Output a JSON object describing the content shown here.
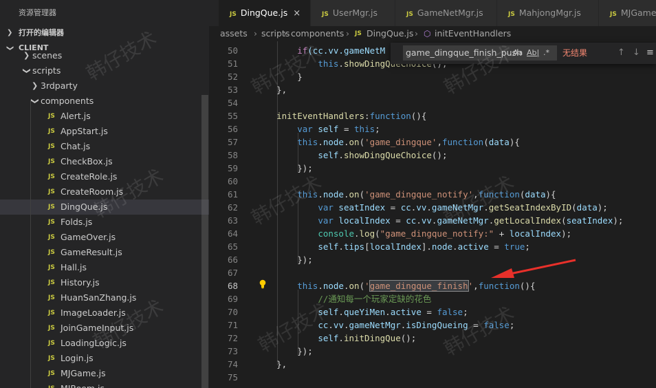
{
  "sidebar": {
    "title": "资源管理器",
    "open_editors": "打开的编辑器",
    "project": "CLIENT",
    "tree": [
      {
        "label": "scenes",
        "indent": 1,
        "kind": "folder-closed"
      },
      {
        "label": "scripts",
        "indent": 1,
        "kind": "folder-open"
      },
      {
        "label": "3rdparty",
        "indent": 2,
        "kind": "folder-closed"
      },
      {
        "label": "components",
        "indent": 2,
        "kind": "folder-open"
      },
      {
        "label": "Alert.js",
        "indent": 3,
        "kind": "file"
      },
      {
        "label": "AppStart.js",
        "indent": 3,
        "kind": "file"
      },
      {
        "label": "Chat.js",
        "indent": 3,
        "kind": "file"
      },
      {
        "label": "CheckBox.js",
        "indent": 3,
        "kind": "file"
      },
      {
        "label": "CreateRole.js",
        "indent": 3,
        "kind": "file"
      },
      {
        "label": "CreateRoom.js",
        "indent": 3,
        "kind": "file"
      },
      {
        "label": "DingQue.js",
        "indent": 3,
        "kind": "file",
        "selected": true
      },
      {
        "label": "Folds.js",
        "indent": 3,
        "kind": "file"
      },
      {
        "label": "GameOver.js",
        "indent": 3,
        "kind": "file"
      },
      {
        "label": "GameResult.js",
        "indent": 3,
        "kind": "file"
      },
      {
        "label": "Hall.js",
        "indent": 3,
        "kind": "file"
      },
      {
        "label": "History.js",
        "indent": 3,
        "kind": "file"
      },
      {
        "label": "HuanSanZhang.js",
        "indent": 3,
        "kind": "file"
      },
      {
        "label": "ImageLoader.js",
        "indent": 3,
        "kind": "file"
      },
      {
        "label": "JoinGameInput.js",
        "indent": 3,
        "kind": "file"
      },
      {
        "label": "LoadingLogic.js",
        "indent": 3,
        "kind": "file"
      },
      {
        "label": "Login.js",
        "indent": 3,
        "kind": "file"
      },
      {
        "label": "MJGame.js",
        "indent": 3,
        "kind": "file"
      },
      {
        "label": "MJRoom.js",
        "indent": 3,
        "kind": "file"
      }
    ]
  },
  "tabs": [
    {
      "label": "DingQue.js",
      "active": true,
      "close": "×"
    },
    {
      "label": "UserMgr.js"
    },
    {
      "label": "GameNetMgr.js"
    },
    {
      "label": "MahjongMgr.js"
    },
    {
      "label": "MJGame.js"
    }
  ],
  "file_badge": "JS",
  "breadcrumb": [
    "assets",
    "scripts",
    "components",
    "DingQue.js",
    "initEventHandlers"
  ],
  "find": {
    "value": "game_dingque_finish_push",
    "opt_case": "Aa",
    "opt_word": "Ab|",
    "opt_regex": ".*",
    "result": "无结果",
    "prev": "↑",
    "next": "↓",
    "more": "≡"
  },
  "watermark": "韩仔技术",
  "colors": {
    "keyword": "#569cd6",
    "control": "#c586c0",
    "string": "#ce9178",
    "function": "#dcdcaa",
    "property": "#9cdcfe",
    "class": "#4ec9b0",
    "comment": "#6a9955",
    "text": "#d4d4d4",
    "arrow": "#e8302a"
  },
  "code": [
    {
      "n": 50,
      "tokens": [
        [
          "        ",
          ""
        ],
        [
          "if",
          "control"
        ],
        [
          "(cc.vv.gameNetM",
          "prop"
        ]
      ]
    },
    {
      "n": 51,
      "tokens": [
        [
          "            ",
          ""
        ],
        [
          "this",
          "kw"
        ],
        [
          ".",
          ""
        ],
        [
          "showDingQueChoice",
          "fn"
        ],
        [
          "();",
          ""
        ]
      ]
    },
    {
      "n": 52,
      "tokens": [
        [
          "        }",
          ""
        ]
      ]
    },
    {
      "n": 53,
      "tokens": [
        [
          "    },",
          ""
        ]
      ]
    },
    {
      "n": 54,
      "tokens": [
        [
          "",
          ""
        ]
      ]
    },
    {
      "n": 55,
      "tokens": [
        [
          "    ",
          ""
        ],
        [
          "initEventHandlers",
          "fn"
        ],
        [
          ":",
          ""
        ],
        [
          "function",
          "kw"
        ],
        [
          "(){",
          ""
        ]
      ]
    },
    {
      "n": 56,
      "tokens": [
        [
          "        ",
          ""
        ],
        [
          "var",
          "kw"
        ],
        [
          " ",
          ""
        ],
        [
          "self",
          "prop"
        ],
        [
          " = ",
          ""
        ],
        [
          "this",
          "kw"
        ],
        [
          ";",
          ""
        ]
      ]
    },
    {
      "n": 57,
      "tokens": [
        [
          "        ",
          ""
        ],
        [
          "this",
          "kw"
        ],
        [
          ".",
          ""
        ],
        [
          "node",
          "prop"
        ],
        [
          ".",
          ""
        ],
        [
          "on",
          "fn"
        ],
        [
          "(",
          ""
        ],
        [
          "'game_dingque'",
          "str"
        ],
        [
          ",",
          ""
        ],
        [
          "function",
          "kw"
        ],
        [
          "(",
          ""
        ],
        [
          "data",
          "prop"
        ],
        [
          "){",
          ""
        ]
      ]
    },
    {
      "n": 58,
      "tokens": [
        [
          "            ",
          ""
        ],
        [
          "self",
          "prop"
        ],
        [
          ".",
          ""
        ],
        [
          "showDingQueChoice",
          "fn"
        ],
        [
          "();",
          ""
        ]
      ]
    },
    {
      "n": 59,
      "tokens": [
        [
          "        });",
          ""
        ]
      ]
    },
    {
      "n": 60,
      "tokens": [
        [
          "",
          ""
        ]
      ]
    },
    {
      "n": 61,
      "tokens": [
        [
          "        ",
          ""
        ],
        [
          "this",
          "kw"
        ],
        [
          ".",
          ""
        ],
        [
          "node",
          "prop"
        ],
        [
          ".",
          ""
        ],
        [
          "on",
          "fn"
        ],
        [
          "(",
          ""
        ],
        [
          "'game_dingque_notify'",
          "str"
        ],
        [
          ",",
          ""
        ],
        [
          "function",
          "kw"
        ],
        [
          "(",
          ""
        ],
        [
          "data",
          "prop"
        ],
        [
          "){",
          ""
        ]
      ]
    },
    {
      "n": 62,
      "tokens": [
        [
          "            ",
          ""
        ],
        [
          "var",
          "kw"
        ],
        [
          " ",
          ""
        ],
        [
          "seatIndex",
          "prop"
        ],
        [
          " = ",
          ""
        ],
        [
          "cc",
          "prop"
        ],
        [
          ".",
          ""
        ],
        [
          "vv",
          "prop"
        ],
        [
          ".",
          ""
        ],
        [
          "gameNetMgr",
          "prop"
        ],
        [
          ".",
          ""
        ],
        [
          "getSeatIndexByID",
          "fn"
        ],
        [
          "(",
          ""
        ],
        [
          "data",
          "prop"
        ],
        [
          ");",
          ""
        ]
      ]
    },
    {
      "n": 63,
      "tokens": [
        [
          "            ",
          ""
        ],
        [
          "var",
          "kw"
        ],
        [
          " ",
          ""
        ],
        [
          "localIndex",
          "prop"
        ],
        [
          " = ",
          ""
        ],
        [
          "cc",
          "prop"
        ],
        [
          ".",
          ""
        ],
        [
          "vv",
          "prop"
        ],
        [
          ".",
          ""
        ],
        [
          "gameNetMgr",
          "prop"
        ],
        [
          ".",
          ""
        ],
        [
          "getLocalIndex",
          "fn"
        ],
        [
          "(",
          ""
        ],
        [
          "seatIndex",
          "prop"
        ],
        [
          ");",
          ""
        ]
      ]
    },
    {
      "n": 64,
      "tokens": [
        [
          "            ",
          ""
        ],
        [
          "console",
          "class"
        ],
        [
          ".",
          ""
        ],
        [
          "log",
          "fn"
        ],
        [
          "(",
          ""
        ],
        [
          "\"game_dingque_notify:\"",
          "str"
        ],
        [
          " + ",
          ""
        ],
        [
          "localIndex",
          "prop"
        ],
        [
          ");",
          ""
        ]
      ]
    },
    {
      "n": 65,
      "tokens": [
        [
          "            ",
          ""
        ],
        [
          "self",
          "prop"
        ],
        [
          ".",
          ""
        ],
        [
          "tips",
          "prop"
        ],
        [
          "[",
          ""
        ],
        [
          "localIndex",
          "prop"
        ],
        [
          "].",
          ""
        ],
        [
          "node",
          "prop"
        ],
        [
          ".",
          ""
        ],
        [
          "active",
          "prop"
        ],
        [
          " = ",
          ""
        ],
        [
          "true",
          "kw"
        ],
        [
          ";",
          ""
        ]
      ]
    },
    {
      "n": 66,
      "tokens": [
        [
          "        });",
          ""
        ]
      ]
    },
    {
      "n": 67,
      "tokens": [
        [
          "",
          ""
        ]
      ]
    },
    {
      "n": 68,
      "tokens": [
        [
          "        ",
          ""
        ],
        [
          "this",
          "kw"
        ],
        [
          ".",
          ""
        ],
        [
          "node",
          "prop"
        ],
        [
          ".",
          ""
        ],
        [
          "on",
          "fn"
        ],
        [
          "(",
          ""
        ],
        [
          "'",
          "str"
        ],
        [
          "game_dingque_finish",
          "str hlbox"
        ],
        [
          "'",
          "str"
        ],
        [
          ",",
          ""
        ],
        [
          "function",
          "kw"
        ],
        [
          "(){",
          ""
        ]
      ]
    },
    {
      "n": 69,
      "tokens": [
        [
          "            ",
          ""
        ],
        [
          "//通知每一个玩家定缺的花色",
          "cmt"
        ]
      ]
    },
    {
      "n": 70,
      "tokens": [
        [
          "            ",
          ""
        ],
        [
          "self",
          "prop"
        ],
        [
          ".",
          ""
        ],
        [
          "queYiMen",
          "prop"
        ],
        [
          ".",
          ""
        ],
        [
          "active",
          "prop"
        ],
        [
          " = ",
          ""
        ],
        [
          "false",
          "kw"
        ],
        [
          ";",
          ""
        ]
      ]
    },
    {
      "n": 71,
      "tokens": [
        [
          "            ",
          ""
        ],
        [
          "cc",
          "prop"
        ],
        [
          ".",
          ""
        ],
        [
          "vv",
          "prop"
        ],
        [
          ".",
          ""
        ],
        [
          "gameNetMgr",
          "prop"
        ],
        [
          ".",
          ""
        ],
        [
          "isDingQueing",
          "prop"
        ],
        [
          " = ",
          ""
        ],
        [
          "false",
          "kw"
        ],
        [
          ";",
          ""
        ]
      ]
    },
    {
      "n": 72,
      "tokens": [
        [
          "            ",
          ""
        ],
        [
          "self",
          "prop"
        ],
        [
          ".",
          ""
        ],
        [
          "initDingQue",
          "fn"
        ],
        [
          "();",
          ""
        ]
      ]
    },
    {
      "n": 73,
      "tokens": [
        [
          "        });",
          ""
        ]
      ]
    },
    {
      "n": 74,
      "tokens": [
        [
          "    },",
          ""
        ]
      ]
    },
    {
      "n": 75,
      "tokens": [
        [
          "",
          ""
        ]
      ]
    }
  ]
}
